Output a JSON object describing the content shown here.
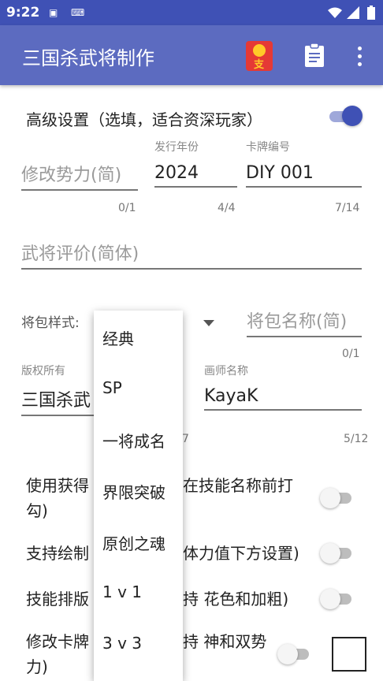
{
  "status_bar": {
    "time": "9:22",
    "battery_icon": "battery-charging-icon",
    "wifi_icon": "wifi-icon",
    "signal_icon": "signal-icon"
  },
  "app_bar": {
    "title": "三国杀武将制作",
    "actions": [
      "red-packet-icon",
      "clipboard-icon",
      "more-vert-icon"
    ]
  },
  "advanced": {
    "label": "高级设置（选填，适合资深玩家）",
    "enabled": true
  },
  "faction": {
    "placeholder": "修改势力(简)",
    "counter": "0/1"
  },
  "year": {
    "label": "发行年份",
    "value": "2024",
    "counter": "4/4"
  },
  "card_no": {
    "label": "卡牌编号",
    "value": "DIY 001",
    "counter": "7/14"
  },
  "review": {
    "placeholder": "武将评价(简体)"
  },
  "pack_style": {
    "label": "将包样式:"
  },
  "pack_name": {
    "placeholder": "将包名称(简)",
    "counter": "0/1"
  },
  "copyright": {
    "label": "版权所有",
    "value": "三国杀武",
    "counter": "7"
  },
  "painter": {
    "label": "画师名称",
    "value": "KayaK",
    "counter": "5/12"
  },
  "options": [
    {
      "left": "使用获得",
      "right": "在技能名称前打",
      "line2": "勾)"
    },
    {
      "left": "支持绘制",
      "right": "体力值下方设置)"
    },
    {
      "left": "技能排版",
      "right": "持 花色和加粗)"
    },
    {
      "left": "修改卡牌",
      "right": "持 神和双势",
      "line2": "力)"
    }
  ],
  "dropdown": {
    "items": [
      "经典",
      "SP",
      "一将成名",
      "界限突破",
      "原创之魂",
      "1 v 1",
      "3 v 3"
    ]
  },
  "colors": {
    "primary": "#5c6bc0",
    "primary_dark": "#3f51b5",
    "accent": "#3f51b5"
  }
}
